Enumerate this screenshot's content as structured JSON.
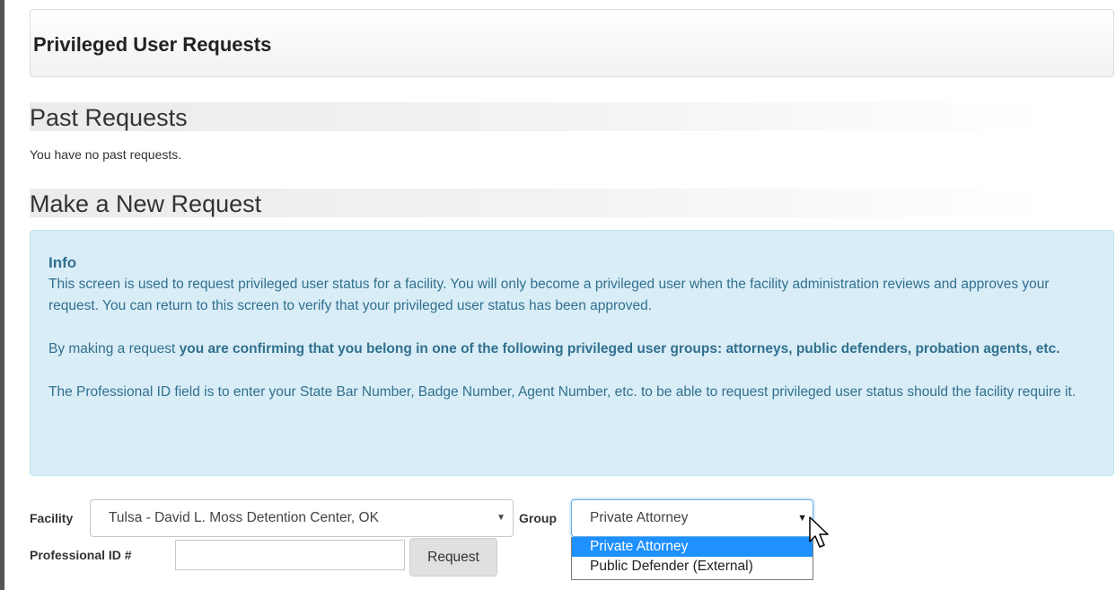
{
  "header": {
    "title": "Privileged User Requests"
  },
  "past": {
    "title": "Past Requests",
    "empty_text": "You have no past requests."
  },
  "new_request": {
    "title": "Make a New Request"
  },
  "info": {
    "title": "Info",
    "p1": "This screen is used to request privileged user status for a facility. You will only become a privileged user when the facility administration reviews and approves your request. You can return to this screen to verify that your privileged user status has been approved.",
    "p2_prefix": "By making a request ",
    "p2_bold": "you are confirming that you belong in one of the following privileged user groups: attorneys, public defenders, probation agents, etc.",
    "p3": "The Professional ID field is to enter your State Bar Number, Badge Number, Agent Number, etc. to be able to request privileged user status should the facility require it."
  },
  "form": {
    "facility_label": "Facility",
    "facility_value": "Tulsa - David L. Moss Detention Center, OK",
    "group_label": "Group",
    "group_value": "Private Attorney",
    "group_options": [
      "Private Attorney",
      "Public Defender (External)"
    ],
    "professional_id_label": "Professional ID #",
    "professional_id_value": "",
    "request_button": "Request"
  },
  "icons": {
    "dropdown_arrow": "▼",
    "cursor": "arrow-cursor-icon"
  },
  "colors": {
    "info_bg": "#d9edf7",
    "info_text": "#31708f",
    "selected_option": "#1e90ff"
  }
}
